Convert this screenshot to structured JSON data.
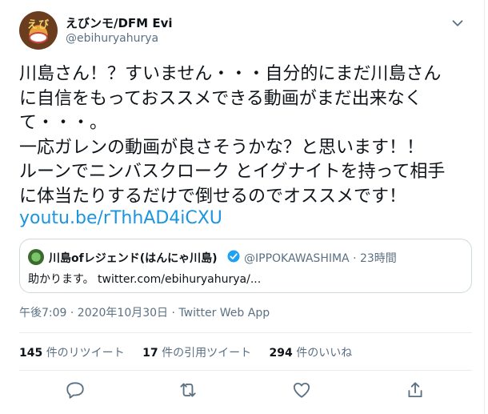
{
  "author": {
    "display_name": "えびンモ/DFM Evi",
    "handle": "@ebihuryahurya",
    "avatar_icon": "avatar-image",
    "avatar_glyph": "えび"
  },
  "tweet": {
    "text": "川島さん！？すいません・・・自分的にまだ川島さん\nに自信をもっておススメできる動画がまだ出来なく\nて・・・。\n一応ガレンの動画が良さそうかな？と思います！！\nルーンでニンバスクローク とイグナイトを持って相手\nに体当たりするだけで倒せるのでオススメです！",
    "link": "youtu.be/rThhAD4iCXU",
    "timestamp": "午後7:09 · 2020年10月30日 · Twitter Web App"
  },
  "quoted": {
    "name": "川島ofレジェンド(はんにゃ川島)",
    "meta": "@IPPOKAWASHIMA · 23時間",
    "body": "助かります。 twitter.com/ebihuryahurya/..."
  },
  "stats": {
    "retweets_count": "145",
    "retweets_label": "件のリツイート",
    "quotes_count": "17",
    "quotes_label": "件の引用ツイート",
    "likes_count": "294",
    "likes_label": "件のいいね"
  },
  "colors": {
    "link": "#1b95e0",
    "muted": "#5b7083",
    "verified": "#1da1f2"
  }
}
